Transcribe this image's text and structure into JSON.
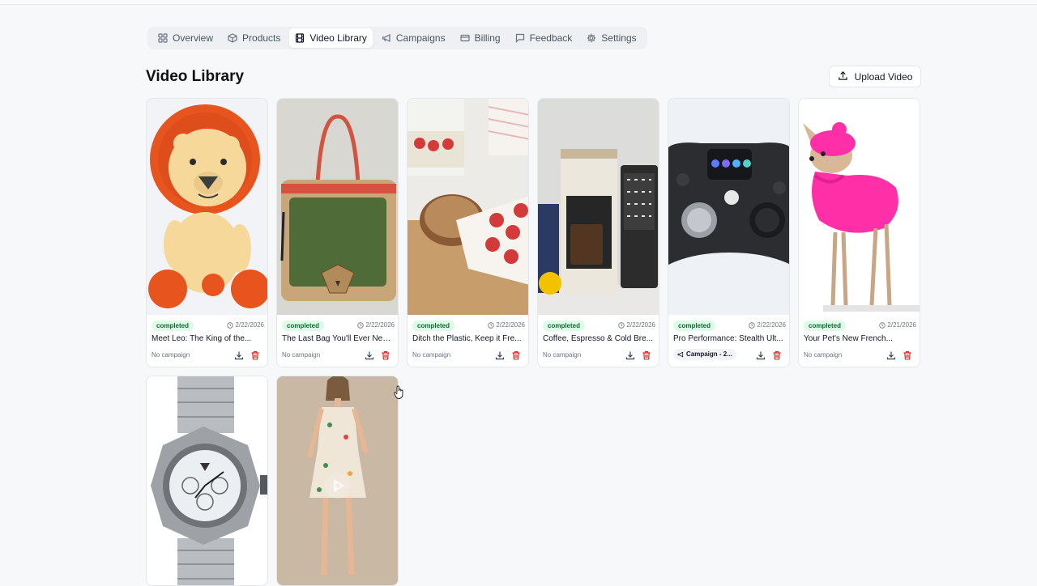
{
  "nav": {
    "items": [
      {
        "label": "Overview",
        "icon": "grid-icon"
      },
      {
        "label": "Products",
        "icon": "box-icon"
      },
      {
        "label": "Video Library",
        "icon": "film-icon",
        "active": true
      },
      {
        "label": "Campaigns",
        "icon": "megaphone-icon"
      },
      {
        "label": "Billing",
        "icon": "credit-card-icon"
      },
      {
        "label": "Feedback",
        "icon": "message-icon"
      },
      {
        "label": "Settings",
        "icon": "gear-icon"
      }
    ]
  },
  "header": {
    "title": "Video Library",
    "upload_label": "Upload Video"
  },
  "colors": {
    "accent_completed_bg": "#dcfce7",
    "accent_completed_text": "#166534",
    "delete_red": "#dc2626"
  },
  "videos": [
    {
      "status": "completed",
      "date": "2/22/2026",
      "title": "Meet Leo: The King of the...",
      "campaign": "No campaign"
    },
    {
      "status": "completed",
      "date": "2/22/2026",
      "title": "The Last Bag You'll Ever Nee...",
      "campaign": "No campaign"
    },
    {
      "status": "completed",
      "date": "2/22/2026",
      "title": "Ditch the Plastic, Keep it Fre...",
      "campaign": "No campaign"
    },
    {
      "status": "completed",
      "date": "2/22/2026",
      "title": "Coffee, Espresso & Cold Bre...",
      "campaign": "No campaign"
    },
    {
      "status": "completed",
      "date": "2/22/2026",
      "title": "Pro Performance: Stealth Ult...",
      "campaign": "Campaign - 2..."
    },
    {
      "status": "completed",
      "date": "2/21/2026",
      "title": "Your Pet's New French...",
      "campaign": "No campaign"
    },
    {
      "status": "",
      "date": "",
      "title": "",
      "campaign": ""
    },
    {
      "status": "",
      "date": "",
      "title": "",
      "campaign": ""
    }
  ]
}
